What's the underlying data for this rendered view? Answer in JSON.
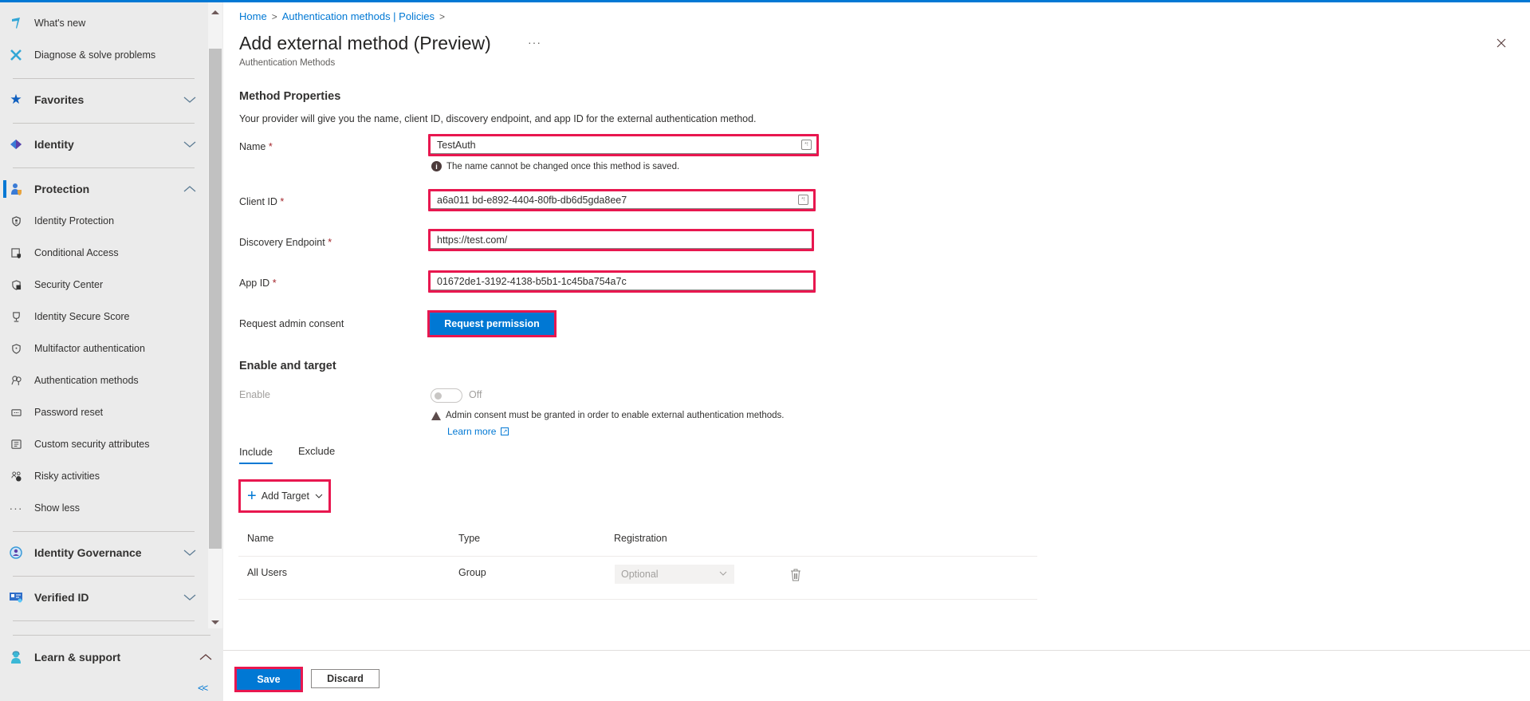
{
  "sidebar": {
    "items": [
      {
        "label": "What's new",
        "icon": "megaphone-icon"
      },
      {
        "label": "Diagnose & solve problems",
        "icon": "wrench-icon"
      },
      {
        "label": "Favorites",
        "icon": "star-icon",
        "group": true,
        "expanded": false
      },
      {
        "label": "Identity",
        "icon": "identity-icon",
        "group": true,
        "expanded": false
      },
      {
        "label": "Protection",
        "icon": "protection-icon",
        "group": true,
        "expanded": true,
        "active": true
      },
      {
        "label": "Identity Protection",
        "icon": "shield-person-icon"
      },
      {
        "label": "Conditional Access",
        "icon": "conditional-access-icon"
      },
      {
        "label": "Security Center",
        "icon": "shield-lock-icon"
      },
      {
        "label": "Identity Secure Score",
        "icon": "trophy-icon"
      },
      {
        "label": "Multifactor authentication",
        "icon": "shield-icon"
      },
      {
        "label": "Authentication methods",
        "icon": "keys-icon"
      },
      {
        "label": "Password reset",
        "icon": "password-icon"
      },
      {
        "label": "Custom security attributes",
        "icon": "attributes-icon"
      },
      {
        "label": "Risky activities",
        "icon": "risky-users-icon"
      },
      {
        "label": "Show less",
        "icon": "ellipsis-icon"
      },
      {
        "label": "Identity Governance",
        "icon": "governance-icon",
        "group": true,
        "expanded": false
      },
      {
        "label": "Verified ID",
        "icon": "verified-id-icon",
        "group": true,
        "expanded": false
      }
    ],
    "learn_support": "Learn & support",
    "collapse_label": "<<"
  },
  "breadcrumb": [
    {
      "label": "Home"
    },
    {
      "label": "Authentication methods | Policies"
    }
  ],
  "header": {
    "title": "Add external method (Preview)",
    "subtitle": "Authentication Methods",
    "more": "···"
  },
  "method_properties": {
    "heading": "Method Properties",
    "description": "Your provider will give you the name, client ID, discovery endpoint, and app ID for the external authentication method.",
    "fields": {
      "name": {
        "label": "Name",
        "value": "TestAuth",
        "hint": "The name cannot be changed once this method is saved."
      },
      "client_id": {
        "label": "Client ID",
        "value": "a6a011 bd-e892-4404-80fb-db6d5gda8ee7"
      },
      "discovery": {
        "label": "Discovery Endpoint",
        "value": "https://test.com/"
      },
      "app_id": {
        "label": "App ID",
        "value": "01672de1-3192-4138-b5b1-1c45ba754a7c"
      }
    },
    "required_mark": "*",
    "consent_label": "Request admin consent",
    "consent_button": "Request permission"
  },
  "enable_target": {
    "heading": "Enable and target",
    "enable_label": "Enable",
    "toggle_state": "Off",
    "warning": "Admin consent must be granted in order to enable external authentication methods.",
    "learn_more": "Learn more",
    "tabs": [
      {
        "label": "Include",
        "active": true
      },
      {
        "label": "Exclude",
        "active": false
      }
    ],
    "add_target": "Add Target",
    "table": {
      "columns": [
        "Name",
        "Type",
        "Registration"
      ],
      "rows": [
        {
          "name": "All Users",
          "type": "Group",
          "registration": "Optional"
        }
      ]
    }
  },
  "footer": {
    "save": "Save",
    "discard": "Discard"
  },
  "colors": {
    "accent": "#0078d4",
    "highlight": "#e8174f"
  }
}
